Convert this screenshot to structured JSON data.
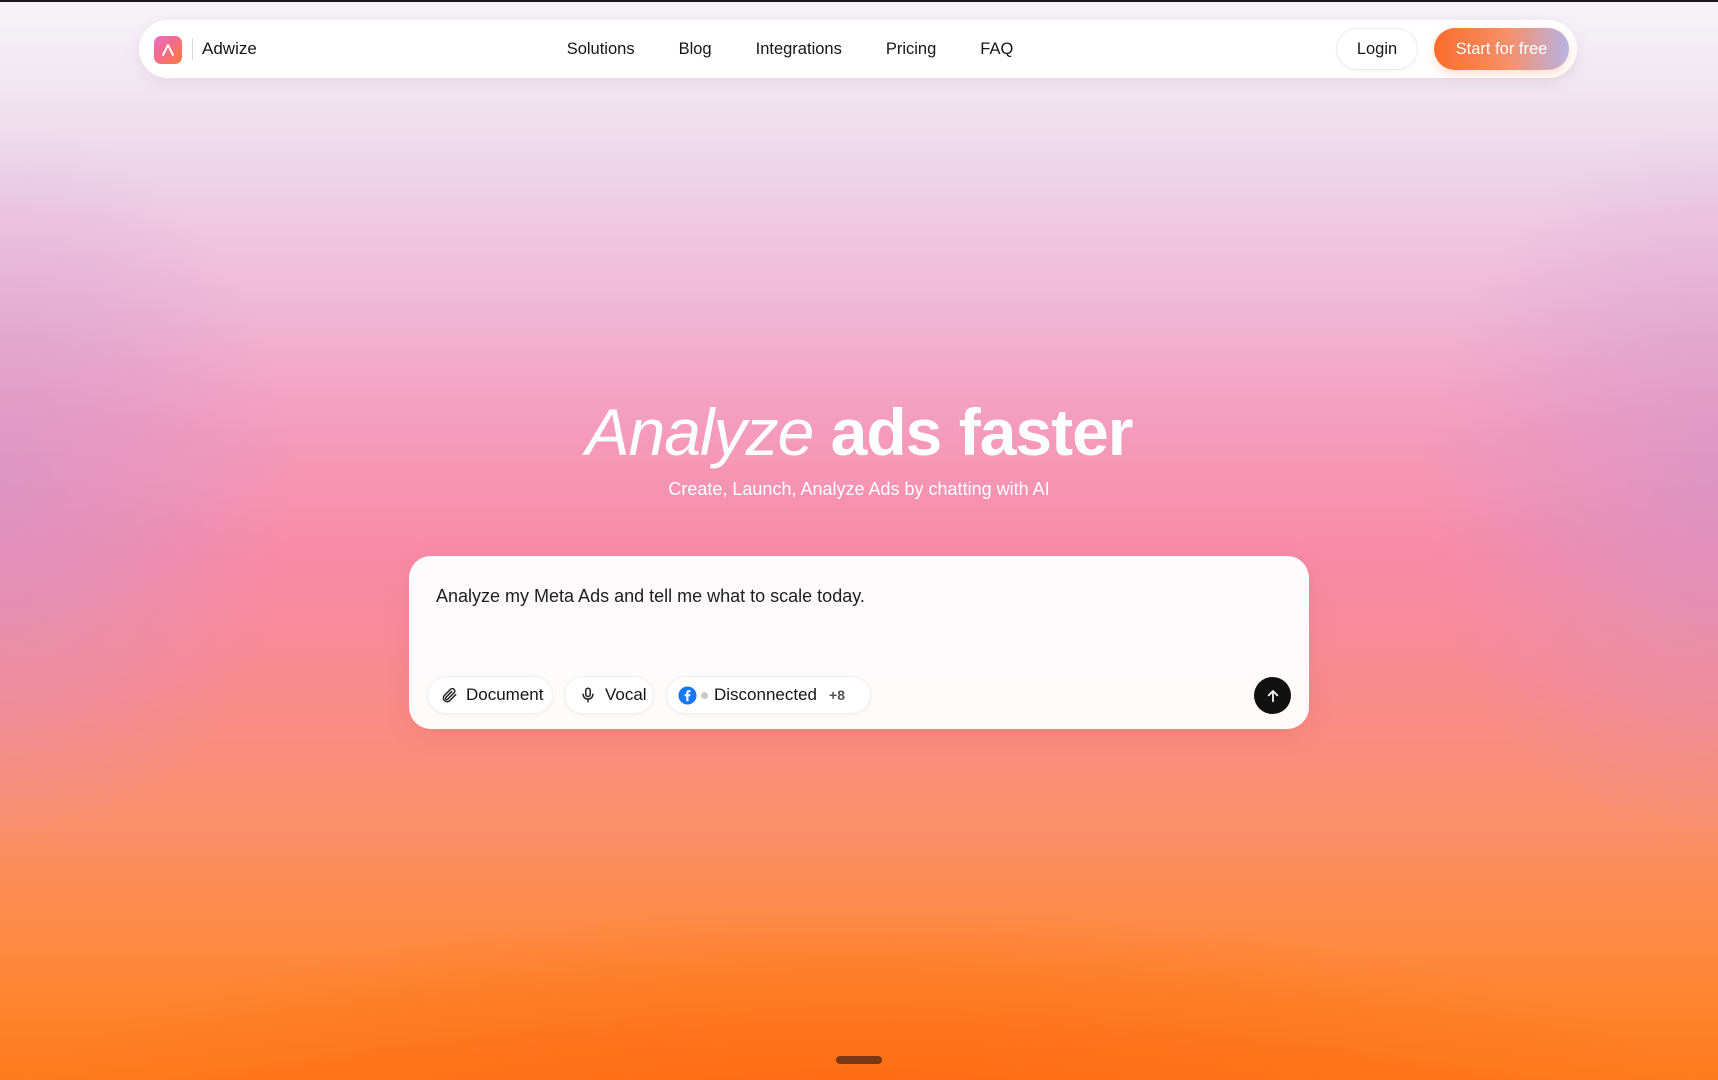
{
  "brand": {
    "name": "Adwize",
    "logo_letter": "A"
  },
  "nav": {
    "links": [
      "Solutions",
      "Blog",
      "Integrations",
      "Pricing",
      "FAQ"
    ],
    "login_label": "Login",
    "cta_label": "Start for free"
  },
  "hero": {
    "title_italic": "Analyze",
    "title_bold": "ads faster",
    "subtitle": "Create, Launch, Analyze Ads by chatting with AI"
  },
  "chat": {
    "input_value": "Analyze my Meta Ads and tell me what to scale today.",
    "chips": {
      "document": {
        "label": "Document",
        "icon": "paperclip-icon"
      },
      "vocal": {
        "label": "Vocal",
        "icon": "microphone-icon"
      },
      "connection": {
        "label": "Disconnected",
        "icon": "facebook-icon",
        "more": "+8"
      }
    },
    "send_icon": "arrow-up-icon"
  },
  "colors": {
    "cta_start": "#fb6c2a",
    "cta_end": "#b7b3e6",
    "send_button": "#111111",
    "facebook_blue": "#1877f2"
  }
}
